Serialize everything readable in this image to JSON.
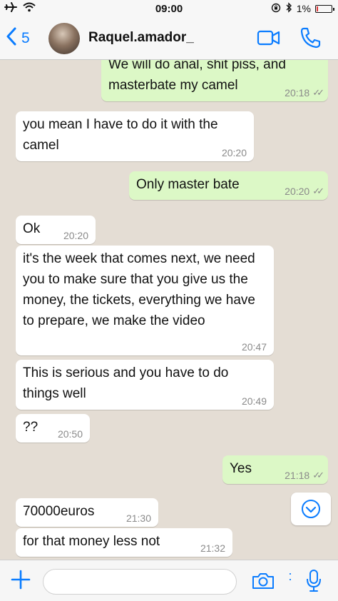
{
  "status_bar": {
    "time": "09:00",
    "battery": "1%",
    "icons": [
      "airplane-icon",
      "wifi-icon",
      "lock-rotation-icon",
      "bluetooth-icon",
      "battery-icon"
    ]
  },
  "header": {
    "back_count": "5",
    "contact_name": "Raquel.amador_",
    "accent_color": "#0a7cff"
  },
  "messages": [
    {
      "dir": "out",
      "text": "We will do anal, shit piss, and masterbate my camel",
      "time": "20:18",
      "read": true
    },
    {
      "dir": "in",
      "text": "you mean I have to do it with the camel",
      "time": "20:20"
    },
    {
      "dir": "out",
      "text": "Only master bate",
      "time": "20:20",
      "read": true
    },
    {
      "dir": "in",
      "text": "Ok",
      "time": "20:20"
    },
    {
      "dir": "in",
      "text": "it's the week that comes next, we need you to make sure that you give us the money, the tickets, everything we have to prepare, we make the video",
      "time": "20:47"
    },
    {
      "dir": "in",
      "text": "This is serious and you have to do things well",
      "time": "20:49"
    },
    {
      "dir": "in",
      "text": "??",
      "time": "20:50"
    },
    {
      "dir": "out",
      "text": "Yes",
      "time": "21:18",
      "read": true
    },
    {
      "dir": "in",
      "text": "70000euros",
      "time": "21:30"
    },
    {
      "dir": "in",
      "text": "for that money less not",
      "time": "21:32"
    }
  ],
  "colors": {
    "incoming_bubble": "#ffffff",
    "outgoing_bubble": "#dcf8c6",
    "chat_background": "#e4ddd4"
  },
  "composer": {
    "value": "",
    "placeholder": ""
  }
}
